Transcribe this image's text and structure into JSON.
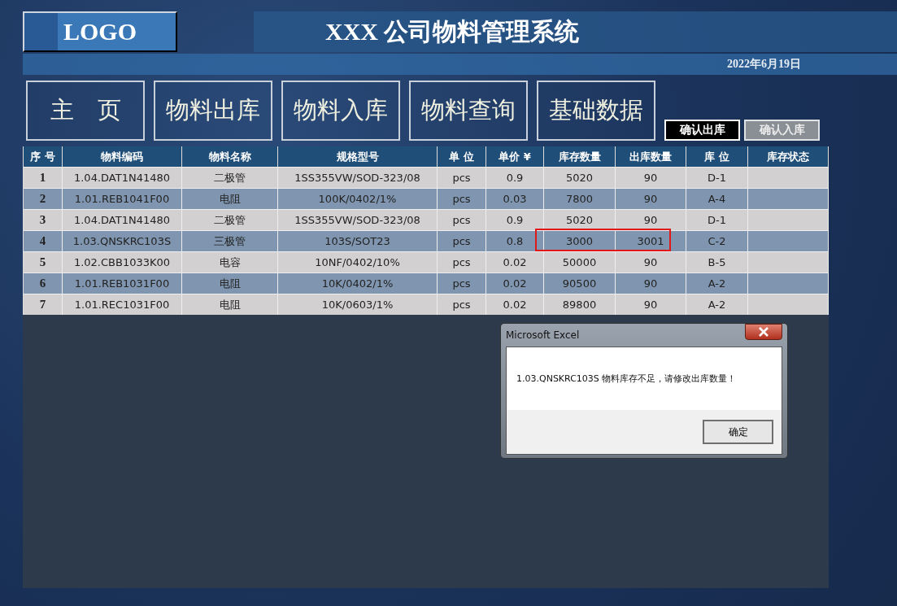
{
  "header": {
    "logo": "LOGO",
    "title": "XXX 公司物料管理系统",
    "date": "2022年6月19日"
  },
  "nav": [
    "主　页",
    "物料出库",
    "物料入库",
    "物料查询",
    "基础数据"
  ],
  "actions": [
    {
      "label": "确认出库",
      "selected": true
    },
    {
      "label": "确认入库",
      "selected": false
    }
  ],
  "table": {
    "columns": [
      "序 号",
      "物料编码",
      "物料名称",
      "规格型号",
      "单  位",
      "单价 ¥",
      "库存数量",
      "出库数量",
      "库  位",
      "库存状态"
    ],
    "rows": [
      {
        "cells": [
          "1",
          "1.04.DAT1N41480",
          "二极管",
          "1SS355VW/SOD-323/08",
          "pcs",
          "0.9",
          "5020",
          "90",
          "D-1"
        ],
        "flagged": false
      },
      {
        "cells": [
          "2",
          "1.01.REB1041F00",
          "电阻",
          "100K/0402/1%",
          "pcs",
          "0.03",
          "7800",
          "90",
          "A-4"
        ],
        "flagged": false
      },
      {
        "cells": [
          "3",
          "1.04.DAT1N41480",
          "二极管",
          "1SS355VW/SOD-323/08",
          "pcs",
          "0.9",
          "5020",
          "90",
          "D-1"
        ],
        "flagged": false
      },
      {
        "cells": [
          "4",
          "1.03.QNSKRC103S",
          "三极管",
          "103S/SOT23",
          "pcs",
          "0.8",
          "3000",
          "3001",
          "C-2"
        ],
        "flagged": true
      },
      {
        "cells": [
          "5",
          "1.02.CBB1033K00",
          "电容",
          "10NF/0402/10%",
          "pcs",
          "0.02",
          "50000",
          "90",
          "B-5"
        ],
        "flagged": false
      },
      {
        "cells": [
          "6",
          "1.01.REB1031F00",
          "电阻",
          "10K/0402/1%",
          "pcs",
          "0.02",
          "90500",
          "90",
          "A-2"
        ],
        "flagged": false
      },
      {
        "cells": [
          "7",
          "1.01.REC1031F00",
          "电阻",
          "10K/0603/1%",
          "pcs",
          "0.02",
          "89800",
          "90",
          "A-2"
        ],
        "flagged": false
      }
    ]
  },
  "dialog": {
    "title": "Microsoft Excel",
    "message": "1.03.QNSKRC103S 物料库存不足，请修改出库数量！",
    "button": "确定"
  }
}
